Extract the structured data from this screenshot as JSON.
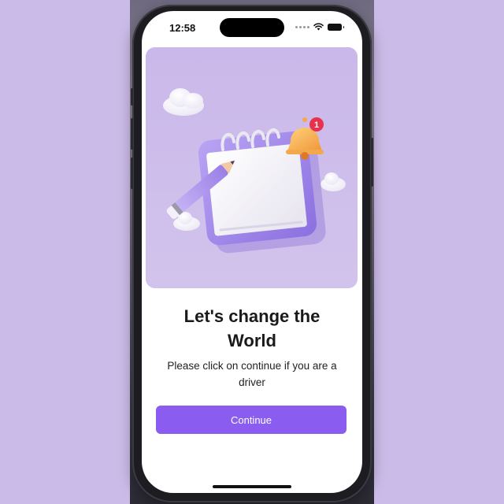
{
  "status_bar": {
    "time": "12:58",
    "icons": [
      "signal-dots-icon",
      "wifi-icon",
      "battery-icon"
    ]
  },
  "hero": {
    "illustration": "notepad-pencil-bell-illustration",
    "notification_count": "1"
  },
  "onboarding": {
    "title": "Let's change the World",
    "subtitle": "Please click on continue if you are a driver",
    "continue_label": "Continue"
  },
  "colors": {
    "page_background": "#cbbbe8",
    "hero_background": "#cdbcea",
    "primary_button": "#8a5cf0",
    "button_text": "#ffffff"
  }
}
